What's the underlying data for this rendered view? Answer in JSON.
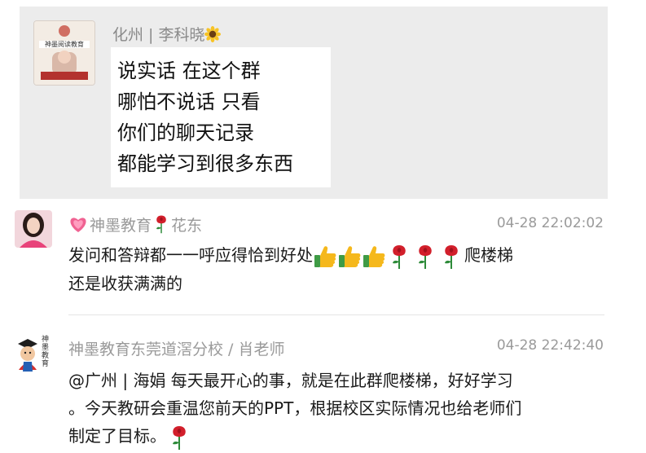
{
  "quoted_message": {
    "sender": "化州 | 李科晓",
    "avatar_text": "神墨阅读教育",
    "lines": [
      "说实话  在这个群",
      "哪怕不说话  只看",
      "你们的聊天记录",
      "都能学习到很多东西"
    ]
  },
  "messages": [
    {
      "sender_prefix": "神墨教育",
      "sender_suffix": "花东",
      "time": "04-28 22:02:02",
      "text_a": "发问和答辩都一一呼应得恰到好处",
      "text_b": "爬楼梯",
      "text_c": "还是收获满满的"
    },
    {
      "sender": "神墨教育东莞道滘分校 / 肖老师",
      "time": "04-28 22:42:40",
      "avatar_caption": "神墨教育",
      "line1": "@广州 | 海娟 每天最开心的事，就是在此群爬楼梯，好好学习",
      "line2": "。今天教研会重温您前天的PPT，根据校区实际情况也给老师们",
      "line3": "制定了目标。"
    }
  ],
  "icons": {
    "thumb": "thumbs-up-icon",
    "rose": "rose-icon",
    "heart": "heart-icon",
    "sunflower": "sunflower-icon"
  },
  "colors": {
    "quoted_bg": "#ececec",
    "meta_text": "#9a9a9a",
    "body_text": "#1a1a1a",
    "rose_red": "#d21f2b",
    "heart_pink": "#f06292",
    "thumb_yellow": "#f5b81c"
  }
}
